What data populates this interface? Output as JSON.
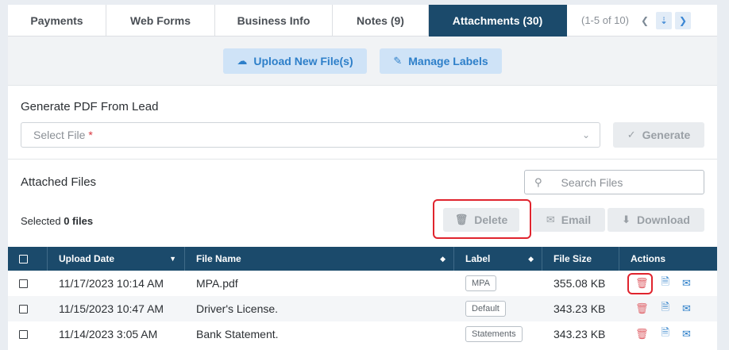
{
  "tabs": [
    {
      "label": "Payments"
    },
    {
      "label": "Web Forms"
    },
    {
      "label": "Business Info"
    },
    {
      "label": "Notes (9)"
    },
    {
      "label": "Attachments (30)"
    }
  ],
  "pager": {
    "text": "(1-5 of 10)"
  },
  "upload": {
    "upload_label": "Upload New File(s)",
    "manage_label": "Manage Labels"
  },
  "generate": {
    "title": "Generate PDF From Lead",
    "select_placeholder": "Select File",
    "required_mark": "*",
    "generate_label": "Generate"
  },
  "attached": {
    "title": "Attached Files",
    "search_placeholder": "Search Files",
    "selected_prefix": "Selected",
    "selected_count": "0 files",
    "delete_label": "Delete",
    "email_label": "Email",
    "download_label": "Download"
  },
  "table": {
    "headers": {
      "upload_date": "Upload Date",
      "file_name": "File Name",
      "label": "Label",
      "file_size": "File Size",
      "actions": "Actions"
    },
    "rows": [
      {
        "date": "11/17/2023 10:14 AM",
        "name": "MPA.pdf",
        "label": "MPA",
        "size": "355.08 KB"
      },
      {
        "date": "11/15/2023 10:47 AM",
        "name": "Driver's License.",
        "label": "Default",
        "size": "343.23 KB"
      },
      {
        "date": "11/14/2023 3:05 AM",
        "name": "Bank Statement.",
        "label": "Statements",
        "size": "343.23 KB"
      }
    ]
  },
  "colors": {
    "accent": "#1b4a6b",
    "highlight": "#e0242e",
    "link": "#2d7fc9"
  }
}
